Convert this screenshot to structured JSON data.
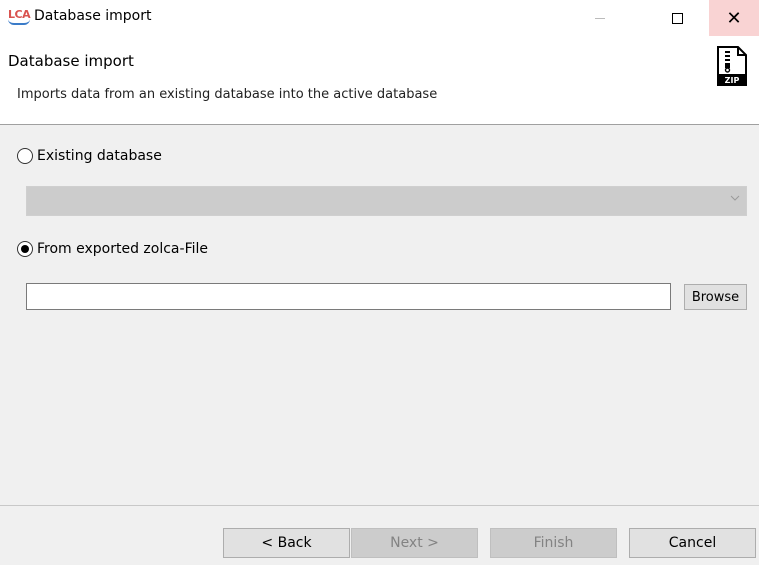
{
  "window": {
    "title": "Database import",
    "app_icon": "lca-icon",
    "close_glyph": "✕"
  },
  "header": {
    "title": "Database import",
    "description": "Imports data from an existing database into the active database",
    "icon": "zip-file-icon",
    "icon_label": "ZIP"
  },
  "options": {
    "existing_database": {
      "label": "Existing database",
      "selected": false
    },
    "database_select": {
      "value": "",
      "disabled": true
    },
    "from_file": {
      "label": "From exported zolca-File",
      "selected": true
    },
    "file_path": {
      "value": ""
    },
    "browse_label": "Browse"
  },
  "footer": {
    "back_label": "< Back",
    "next_label": "Next >",
    "finish_label": "Finish",
    "cancel_label": "Cancel"
  },
  "colors": {
    "close_hover": "#f9d3d3",
    "disabled_button": "#cccccc",
    "button_face": "#e1e1e1",
    "panel": "#f0f0f0"
  }
}
